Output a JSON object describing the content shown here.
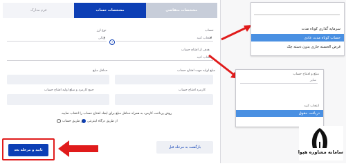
{
  "tabs": {
    "customer_info": "مشخصات متقاضی",
    "account_info": "مشخصات حساب",
    "user_info": "فرم مدارک"
  },
  "form": {
    "account_label": "حساب",
    "account_placeholder": "انتخاب کنید",
    "currency_label": "نوع ارز",
    "currency_value": "ریالی",
    "purpose_label": "هدف از افتتاح حساب",
    "purpose_placeholder": "انتخاب کنید",
    "min_label": "حداقل مبلغ",
    "amount_label": "مبلغ اولیه جهت افتتاح حساب",
    "total_label": "جمع کارمزد و مبلغ اولیه افتتاح حساب",
    "fee_label": "کارمزد افتتاح حساب",
    "note": "روش پرداخت کارمزد به همراه حداقل مبلغ برای ایجاد افتتاح حساب را انتخاب نمایید.",
    "radio_internet": "از طریق درگاه اینترنتی",
    "radio_account": "از طریق حساب"
  },
  "buttons": {
    "confirm_next": "تایید و مرحله بعد",
    "back_prev": "بازگشت به مرحله قبل"
  },
  "popup1": {
    "items": [
      "سرمایه گذاری کوتاه مدت",
      "حساب کوتاه مدت عادی",
      "قرض الحسنه جاری بدون دسته چک"
    ]
  },
  "popup2": {
    "label": "مبلغ و افتتاح حساب",
    "field": "سایر",
    "placeholder": "انتخاب کنید",
    "selected": "دریافت حقوق"
  },
  "logo": {
    "text": "سامانه مشاوره هپوا"
  },
  "colors": {
    "primary": "#0d3fb5",
    "highlight": "#e01b1b",
    "selection": "#4a90e2"
  }
}
